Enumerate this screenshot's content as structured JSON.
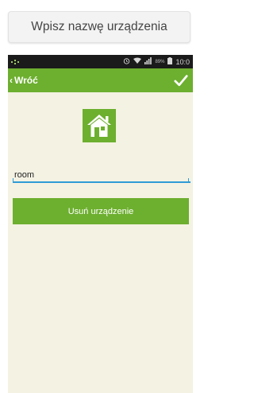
{
  "tooltip": {
    "text": "Wpisz nazwę urządzenia"
  },
  "statusbar": {
    "signal": "89%",
    "time": "10:0"
  },
  "appbar": {
    "back_label": "Wróć",
    "confirm_icon": "check-icon"
  },
  "device": {
    "icon": "house-icon",
    "name_value": "room"
  },
  "actions": {
    "delete_label": "Usuń urządzenie"
  },
  "colors": {
    "accent": "#6daf2f",
    "background": "#f4f2e3",
    "input_underline": "#2f9bd6",
    "statusbar": "#1b1b1b"
  }
}
